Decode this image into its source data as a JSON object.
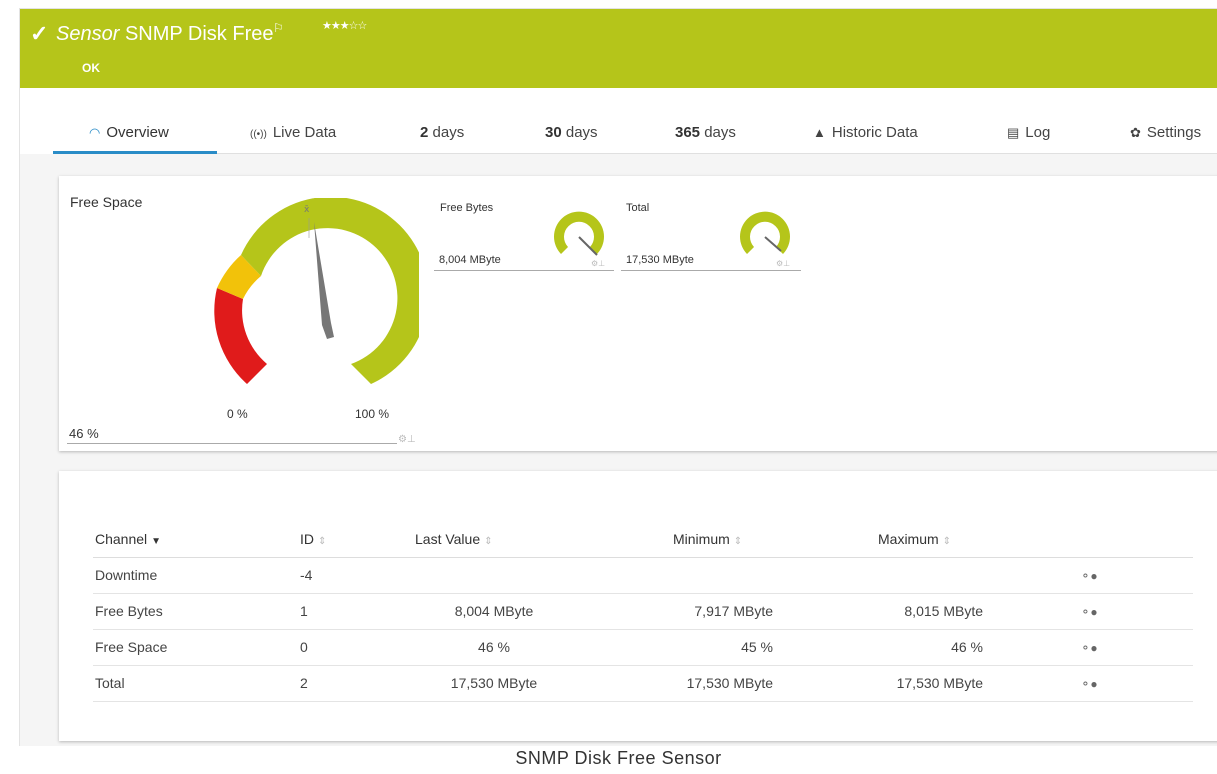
{
  "header": {
    "title_prefix": "Sensor",
    "title": "SNMP Disk Free",
    "flag_glyph": "⚐",
    "stars": "★★★☆☆",
    "status": "OK",
    "bg_color": "#b5c51a"
  },
  "tabs": [
    {
      "label": "Overview",
      "icon": "gauge-icon",
      "glyph": "◠"
    },
    {
      "label": "Live Data",
      "icon": "live-icon",
      "glyph": "((•))"
    },
    {
      "num": "2",
      "label": "days"
    },
    {
      "num": "30",
      "label": "days"
    },
    {
      "num": "365",
      "label": "days"
    },
    {
      "label": "Historic Data",
      "icon": "chart-icon",
      "glyph": "▲"
    },
    {
      "label": "Log",
      "icon": "log-icon",
      "glyph": "▤"
    },
    {
      "label": "Settings",
      "icon": "gear-icon",
      "glyph": "✿"
    }
  ],
  "gauges": {
    "main": {
      "title": "Free Space",
      "value": "46 %",
      "min_label": "0 %",
      "max_label": "100 %",
      "avg_marker": "x̄",
      "percent": 46
    },
    "free_bytes": {
      "title": "Free Bytes",
      "value": "8,004 MByte"
    },
    "total": {
      "title": "Total",
      "value": "17,530 MByte"
    }
  },
  "table": {
    "headers": {
      "channel": "Channel",
      "id": "ID",
      "last": "Last Value",
      "min": "Minimum",
      "max": "Maximum"
    },
    "rows": [
      {
        "channel": "Downtime",
        "id": "-4",
        "last": "",
        "min": "",
        "max": ""
      },
      {
        "channel": "Free Bytes",
        "id": "1",
        "last": "8,004 MByte",
        "min": "7,917 MByte",
        "max": "8,015 MByte"
      },
      {
        "channel": "Free Space",
        "id": "0",
        "last": "46 %",
        "min": "45 %",
        "max": "46 %"
      },
      {
        "channel": "Total",
        "id": "2",
        "last": "17,530 MByte",
        "min": "17,530 MByte",
        "max": "17,530 MByte"
      }
    ]
  },
  "caption": "SNMP Disk Free Sensor"
}
